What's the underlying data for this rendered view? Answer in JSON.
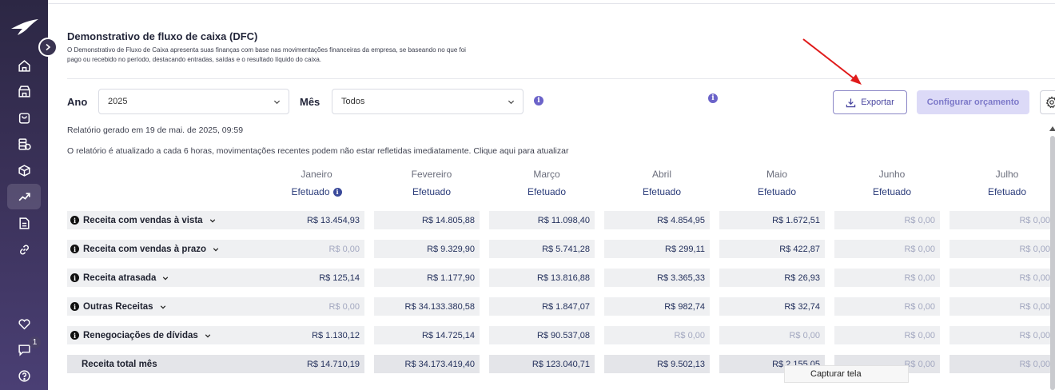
{
  "sidebar": {
    "items": [
      {
        "icon": "home-icon"
      },
      {
        "icon": "store-icon"
      },
      {
        "icon": "shopping-bag-icon"
      },
      {
        "icon": "coins-icon"
      },
      {
        "icon": "box-icon"
      },
      {
        "icon": "trending-up-icon",
        "active": true
      },
      {
        "icon": "document-icon"
      },
      {
        "icon": "link-icon"
      }
    ],
    "bottom": [
      {
        "icon": "heart-icon"
      },
      {
        "icon": "chat-icon",
        "badge": "1"
      },
      {
        "icon": "help-icon"
      }
    ]
  },
  "header": {
    "title": "Demonstrativo de fluxo de caixa (DFC)",
    "description": "O Demonstrativo de Fluxo de Caixa apresenta suas finanças com base nas movimentações financeiras da empresa, se baseando no que foi pago ou recebido no período, destacando entradas, saídas e o resultado líquido do caixa."
  },
  "filters": {
    "year_label": "Ano",
    "year_value": "2025",
    "month_label": "Mês",
    "month_value": "Todos"
  },
  "actions": {
    "export_label": "Exportar",
    "budget_label": "Configurar orçamento"
  },
  "report": {
    "generated": "Relatório gerado em 19 de mai. de 2025, 09:59",
    "note": "O relatório é atualizado a cada 6 horas, movimentações recentes podem não estar refletidas imediatamente. Clique aqui para atualizar"
  },
  "table": {
    "months": [
      "Janeiro",
      "Fevereiro",
      "Março",
      "Abril",
      "Maio",
      "Junho",
      "Julho"
    ],
    "status": "Efetuado",
    "rows": [
      {
        "label": "Receita com vendas à vista",
        "values": [
          "R$ 13.454,93",
          "R$ 14.805,88",
          "R$ 11.098,40",
          "R$ 4.854,95",
          "R$ 1.672,51",
          "R$ 0,00",
          "R$ 0,00"
        ]
      },
      {
        "label": "Receita com vendas à prazo",
        "values": [
          "R$ 0,00",
          "R$ 9.329,90",
          "R$ 5.741,28",
          "R$ 299,11",
          "R$ 422,87",
          "R$ 0,00",
          "R$ 0,00"
        ]
      },
      {
        "label": "Receita atrasada",
        "values": [
          "R$ 125,14",
          "R$ 1.177,90",
          "R$ 13.816,88",
          "R$ 3.365,33",
          "R$ 26,93",
          "R$ 0,00",
          "R$ 0,00"
        ]
      },
      {
        "label": "Outras Receitas",
        "values": [
          "R$ 0,00",
          "R$ 34.133.380,58",
          "R$ 1.847,07",
          "R$ 982,74",
          "R$ 32,74",
          "R$ 0,00",
          "R$ 0,00"
        ]
      },
      {
        "label": "Renegociações de dívidas",
        "values": [
          "R$ 1.130,12",
          "R$ 14.725,14",
          "R$ 90.537,08",
          "R$ 0,00",
          "R$ 0,00",
          "R$ 0,00",
          "R$ 0,00"
        ]
      }
    ],
    "total": {
      "label": "Receita total mês",
      "values": [
        "R$ 14.710,19",
        "R$ 34.173.419,40",
        "R$ 123.040,71",
        "R$ 9.502,13",
        "R$ 2.155,05",
        "R$ 0,00",
        "R$ 0,00"
      ]
    }
  },
  "tooltip": "Capturar tela",
  "colors": {
    "accent": "#4a47a0",
    "annotation_arrow": "#e01b1b"
  }
}
